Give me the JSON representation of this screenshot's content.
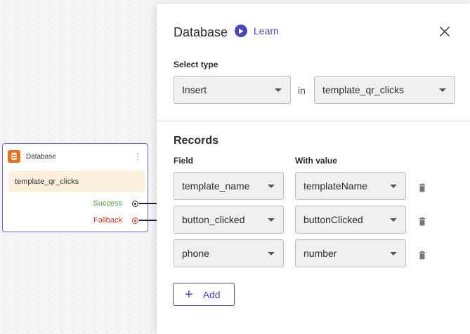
{
  "node": {
    "title": "Database",
    "chip": "template_qr_clicks",
    "outputs": {
      "success": "Success",
      "fallback": "Fallback"
    },
    "icon": "database-icon",
    "icon_color": "#e8701f"
  },
  "panel": {
    "title": "Database",
    "learn_label": "Learn",
    "select_type_label": "Select type",
    "type_value": "Insert",
    "in_label": "in",
    "table_value": "template_qr_clicks",
    "records_title": "Records",
    "field_header": "Field",
    "value_header": "With value",
    "records": [
      {
        "field": "template_name",
        "value": "templateName"
      },
      {
        "field": "button_clicked",
        "value": "buttonClicked"
      },
      {
        "field": "phone",
        "value": "number"
      }
    ],
    "add_label": "Add",
    "accent_color": "#4b46b8"
  }
}
